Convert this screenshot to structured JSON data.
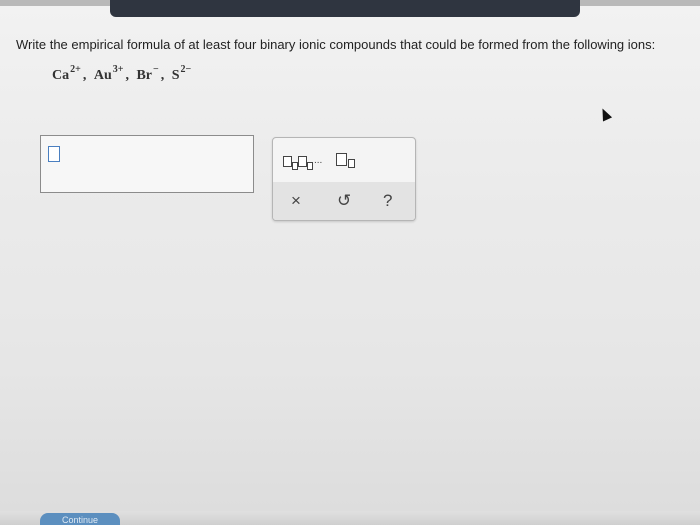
{
  "question": {
    "text": "Write the empirical formula of at least four binary ionic compounds that could be formed from the following ions:"
  },
  "ions": [
    {
      "symbol": "Ca",
      "charge": "2+"
    },
    {
      "symbol": "Au",
      "charge": "3+"
    },
    {
      "symbol": "Br",
      "charge": "−"
    },
    {
      "symbol": "S",
      "charge": "2−"
    }
  ],
  "separator": ",",
  "answer": {
    "value": ""
  },
  "palette": {
    "multi_template_dots": "...",
    "clear_glyph": "×",
    "undo_glyph": "↺",
    "help_glyph": "?"
  },
  "footer": {
    "continue_label": "Continue"
  },
  "colors": {
    "accent": "#5c8fbf",
    "top_bar": "#2f3540",
    "cursor_slot_border": "#4a7fc0"
  },
  "icons": [
    "subscript-template-icon",
    "subscript-template-icon",
    "clear-icon",
    "undo-icon",
    "help-icon",
    "mouse-pointer-icon"
  ]
}
